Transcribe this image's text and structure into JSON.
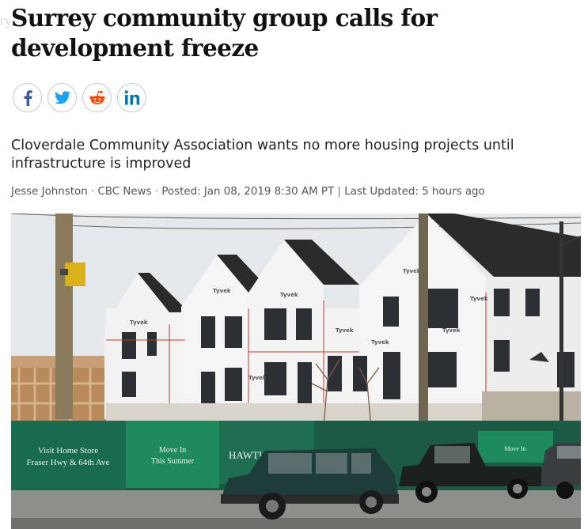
{
  "ghost_text": "ry",
  "headline": "Surrey community group calls for development freeze",
  "share": {
    "facebook_icon": "facebook-icon",
    "twitter_icon": "twitter-icon",
    "reddit_icon": "reddit-icon",
    "linkedin_icon": "linkedin-icon"
  },
  "deck": "Cloverdale Community Association wants no more housing projects until infrastructure is improved",
  "byline": {
    "author": "Jesse Johnston",
    "outlet": "CBC News",
    "posted": "Posted: Jan 08, 2019 8:30 AM PT",
    "separator": "|",
    "updated": "Last Updated: 5 hours ago"
  },
  "photo": {
    "fence_sign_left_line1": "Visit Home Store",
    "fence_sign_left_line2": "Fraser Hwy & 64th Ave",
    "fence_sign_mid_line1": "Move In",
    "fence_sign_mid_line2": "This Summer",
    "fence_sign_brand": "HAWTHORNE",
    "fence_sign_right": "Move In",
    "wrap_label": "Tyvek"
  },
  "colors": {
    "facebook": "#3b5998",
    "twitter": "#1da1f2",
    "reddit": "#ff4500",
    "linkedin": "#0077b5",
    "fence_green": "#1f8a5b"
  }
}
